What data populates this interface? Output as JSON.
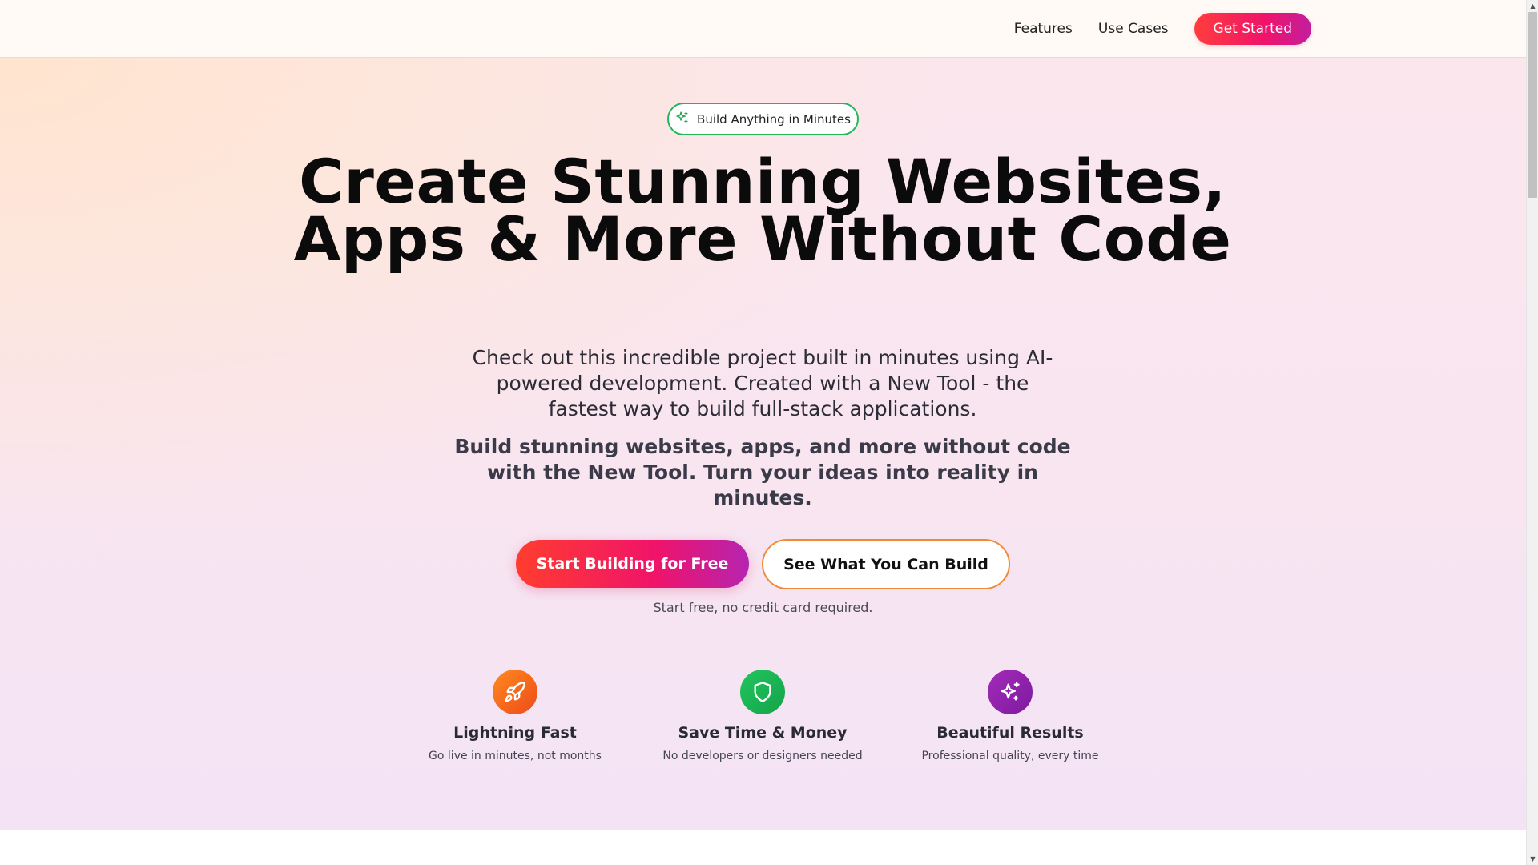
{
  "nav": {
    "features": "Features",
    "use_cases": "Use Cases",
    "cta": "Get Started"
  },
  "hero": {
    "badge": "Build Anything in Minutes",
    "badge_icon": "sparkles-icon",
    "headline": "Create Stunning Websites, Apps & More Without Code",
    "subtitle": "Check out this incredible project built in minutes using AI-powered development. Created with a New Tool - the fastest way to build full-stack applications.",
    "subtitle_bold": "Build stunning websites, apps, and more without code with the New Tool. Turn your ideas into reality in minutes.",
    "primary_button": "Start Building for Free",
    "secondary_button": "See What You Can Build",
    "note": "Start free, no credit card required."
  },
  "features": [
    {
      "icon": "rocket-icon",
      "title": "Lightning Fast",
      "desc": "Go live in minutes, not months",
      "color": "#f26a1b"
    },
    {
      "icon": "shield-icon",
      "title": "Save Time & Money",
      "desc": "No developers or designers needed",
      "color": "#19b856"
    },
    {
      "icon": "sparkles-icon",
      "title": "Beautiful Results",
      "desc": "Professional quality, every time",
      "color": "#8e1fa8"
    }
  ],
  "colors": {
    "accent_red": "#ff3d3d",
    "accent_pink": "#f0136a",
    "accent_purple": "#c21e9e",
    "badge_border": "#22b859",
    "secondary_border": "#f08a3a"
  }
}
